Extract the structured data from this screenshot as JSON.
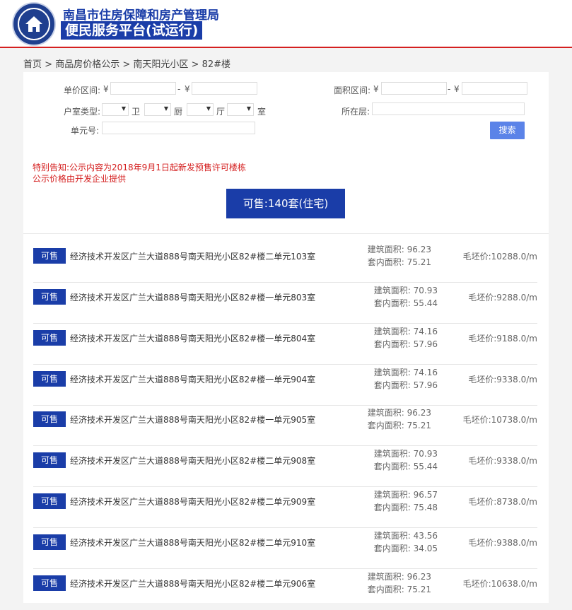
{
  "header": {
    "org_name": "南昌市住房保障和房产管理局",
    "platform_name": "便民服务平台(试运行)"
  },
  "breadcrumb": [
    "首页",
    "商品房价格公示",
    "南天阳光小区",
    "82#楼"
  ],
  "breadcrumb_sep": " > ",
  "filters": {
    "unit_price_label": "单价区间:",
    "area_label": "面积区间:",
    "currency": "¥",
    "range_sep": "-",
    "room_type_label": "户室类型:",
    "room_units": [
      "卫",
      "厨",
      "厅",
      "室"
    ],
    "floor_label": "所在层:",
    "unit_no_label": "单元号:",
    "search_button": "搜索"
  },
  "notice": {
    "line1": "特别告知:公示内容为2018年9月1日起新发预售许可楼栋",
    "line2": "公示价格由开发企业提供"
  },
  "available_banner": "可售:140套(住宅)",
  "listings": [
    {
      "status": "可售",
      "address": "经济技术开发区广兰大道888号南天阳光小区82#楼二单元103室",
      "built_area": "建筑面积:  96.23",
      "inner_area": "套内面积:  75.21",
      "price": "毛坯价:10288.0/m"
    },
    {
      "status": "可售",
      "address": "经济技术开发区广兰大道888号南天阳光小区82#楼一单元803室",
      "built_area": "建筑面积:  70.93",
      "inner_area": "套内面积:  55.44",
      "price": "毛坯价:9288.0/m"
    },
    {
      "status": "可售",
      "address": "经济技术开发区广兰大道888号南天阳光小区82#楼一单元804室",
      "built_area": "建筑面积:  74.16",
      "inner_area": "套内面积:  57.96",
      "price": "毛坯价:9188.0/m"
    },
    {
      "status": "可售",
      "address": "经济技术开发区广兰大道888号南天阳光小区82#楼一单元904室",
      "built_area": "建筑面积:  74.16",
      "inner_area": "套内面积:  57.96",
      "price": "毛坯价:9338.0/m"
    },
    {
      "status": "可售",
      "address": "经济技术开发区广兰大道888号南天阳光小区82#楼一单元905室",
      "built_area": "建筑面积:  96.23",
      "inner_area": "套内面积:  75.21",
      "price": "毛坯价:10738.0/m"
    },
    {
      "status": "可售",
      "address": "经济技术开发区广兰大道888号南天阳光小区82#楼二单元908室",
      "built_area": "建筑面积:  70.93",
      "inner_area": "套内面积:  55.44",
      "price": "毛坯价:9338.0/m"
    },
    {
      "status": "可售",
      "address": "经济技术开发区广兰大道888号南天阳光小区82#楼二单元909室",
      "built_area": "建筑面积:  96.57",
      "inner_area": "套内面积:  75.48",
      "price": "毛坯价:8738.0/m"
    },
    {
      "status": "可售",
      "address": "经济技术开发区广兰大道888号南天阳光小区82#楼二单元910室",
      "built_area": "建筑面积:  43.56",
      "inner_area": "套内面积:  34.05",
      "price": "毛坯价:9388.0/m"
    },
    {
      "status": "可售",
      "address": "经济技术开发区广兰大道888号南天阳光小区82#楼二单元906室",
      "built_area": "建筑面积:  96.23",
      "inner_area": "套内面积:  75.21",
      "price": "毛坯价:10638.0/m"
    }
  ],
  "colors": {
    "brand_blue": "#1a3da8",
    "button_blue": "#5b83e8",
    "alert_red": "#d41d1d",
    "header_rule": "#d42020"
  }
}
